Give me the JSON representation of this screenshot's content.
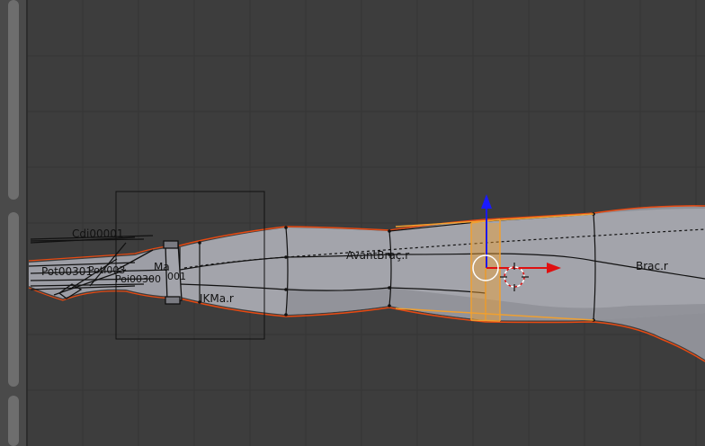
{
  "viewport": {
    "background": "#3d3d3d",
    "grid_color": "#333333",
    "mesh_fill": "#9a9ba2",
    "wire_color": "#111111",
    "outline_color": "#e84a12",
    "selected_color": "#f0a030",
    "axis_z_color": "#1a1aff",
    "axis_x_color": "#e01010"
  },
  "bones": {
    "avant_brac": "AvantBraç.r",
    "brac": "Brac.r",
    "ma": "Ma",
    "ik_ma": "IKMa.r",
    "finger_cluster_top": "Cdi00001",
    "finger_cluster_mid": "Pot00301",
    "finger_cluster_low": "Poti003",
    "finger_cluster_bottom": "Poi00300",
    "ma_sub": "001"
  },
  "icons": {
    "left_scroll_top": "scrollbar-handle",
    "left_scroll_bottom": "scrollbar-handle",
    "pivot": "pivot-circle-icon",
    "cursor": "3d-cursor-icon",
    "manipulator_z": "arrow-up-icon",
    "manipulator_x": "arrow-right-icon"
  }
}
